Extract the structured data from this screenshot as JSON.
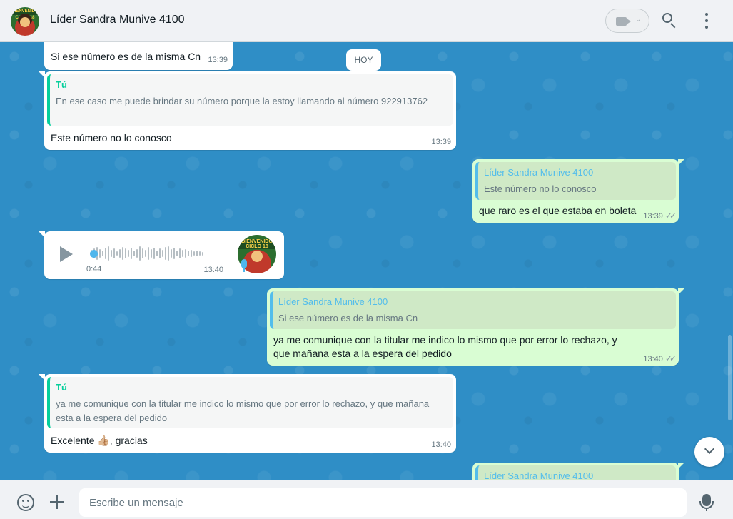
{
  "header": {
    "contact_name": "Líder Sandra Munive 4100",
    "avatar_text": "BIENVENIDO CICLO 18"
  },
  "date_divider": "HOY",
  "messages": [
    {
      "direction": "in",
      "text": "Si ese número es de la misma Cn",
      "time": "13:39"
    },
    {
      "direction": "in",
      "quote_author": "Tú",
      "quote_text": "En ese caso me puede brindar su número porque la estoy llamando al número 922913762",
      "text": "Este número no lo conosco",
      "time": "13:39"
    },
    {
      "direction": "out",
      "quote_author": "Líder Sandra Munive 4100",
      "quote_text": "Este número no lo conosco",
      "text": "que raro es el que estaba en boleta",
      "time": "13:39"
    },
    {
      "direction": "in",
      "type": "voice",
      "duration": "0:44",
      "time": "13:40",
      "avatar_text": "BIENVENIDO CICLO 18"
    },
    {
      "direction": "out",
      "quote_author": "Líder Sandra Munive 4100",
      "quote_text": "Si ese número es de la misma Cn",
      "text": "ya me comunique con la titular me indico lo mismo que por error lo rechazo, y que mañana esta a la espera del pedido",
      "time": "13:40"
    },
    {
      "direction": "in",
      "quote_author": "Tú",
      "quote_text": "ya me comunique con la titular me indico lo mismo que por error lo rechazo, y que mañana esta a la espera del pedido",
      "text": "Excelente 👍🏼, gracias",
      "time": "13:40"
    },
    {
      "direction": "out",
      "quote_author": "Líder Sandra Munive 4100"
    }
  ],
  "footer": {
    "placeholder": "Escribe un mensaje"
  },
  "colors": {
    "chat_background": "#2f8ec6",
    "incoming": "#ffffff",
    "outgoing": "#d9fdd3",
    "quote_accent_in": "#06cf9c",
    "quote_accent_out": "#53bdeb"
  }
}
